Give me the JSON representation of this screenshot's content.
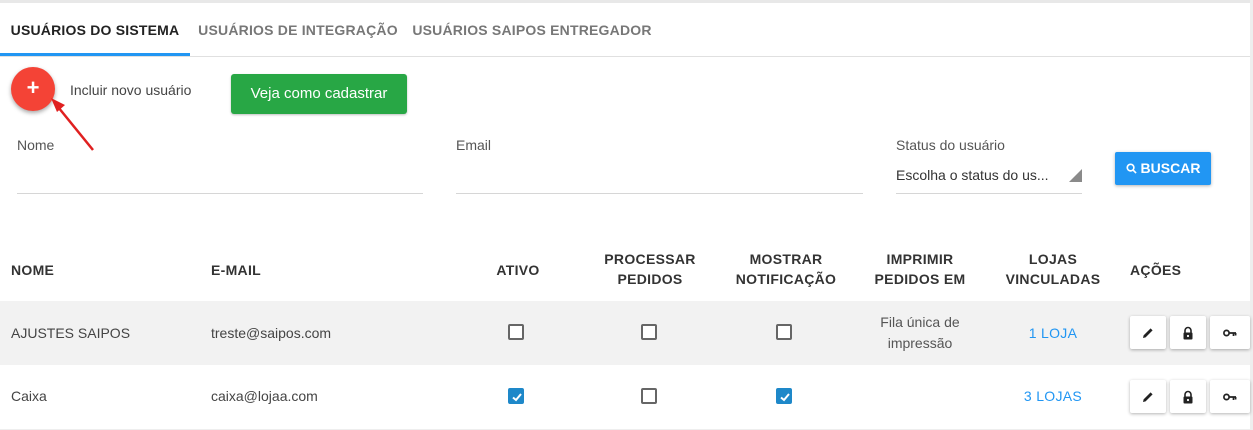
{
  "tabs": [
    {
      "label": "USUÁRIOS DO SISTEMA",
      "active": true
    },
    {
      "label": "USUÁRIOS DE INTEGRAÇÃO",
      "active": false
    },
    {
      "label": "USUÁRIOS SAIPOS ENTREGADOR",
      "active": false
    }
  ],
  "add": {
    "icon": "+",
    "label": "Incluir novo usuário",
    "how_to_label": "Veja como cadastrar"
  },
  "filters": {
    "name_label": "Nome",
    "email_label": "Email",
    "status_label": "Status do usuário",
    "status_value": "Escolha o status do us...",
    "search_label": "BUSCAR"
  },
  "table": {
    "headers": {
      "name": "NOME",
      "email": "E-MAIL",
      "active": "ATIVO",
      "process_l1": "PROCESSAR",
      "process_l2": "PEDIDOS",
      "notify_l1": "MOSTRAR",
      "notify_l2": "NOTIFICAÇÃO",
      "print_l1": "IMPRIMIR",
      "print_l2": "PEDIDOS EM",
      "stores_l1": "LOJAS",
      "stores_l2": "VINCULADAS",
      "actions": "AÇÕES"
    },
    "rows": [
      {
        "name": "AJUSTES SAIPOS",
        "email": "treste@saipos.com",
        "active": false,
        "process": false,
        "notify": false,
        "print_l1": "Fila única de",
        "print_l2": "impressão",
        "stores": "1 LOJA"
      },
      {
        "name": "Caixa",
        "email": "caixa@lojaa.com",
        "active": true,
        "process": false,
        "notify": true,
        "print_l1": "",
        "print_l2": "",
        "stores": "3 LOJAS"
      }
    ]
  },
  "colors": {
    "accent": "#2196f3",
    "fab": "#f44336",
    "green": "#28a745",
    "checked": "#1e88c9"
  }
}
